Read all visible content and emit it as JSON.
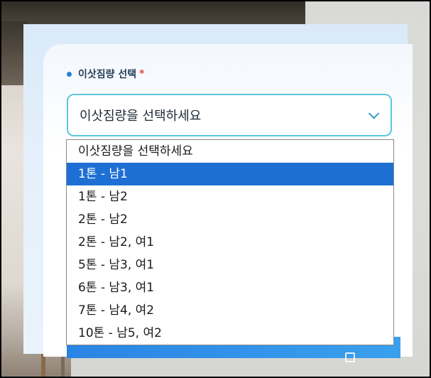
{
  "field": {
    "label": "이삿짐량 선택",
    "required_mark": "*"
  },
  "select": {
    "value": "이삿짐량을 선택하세요"
  },
  "dropdown": {
    "options": [
      "이삿짐량을 선택하세요",
      "1톤 - 남1",
      "1톤 - 남2",
      "2톤 - 남2",
      "2톤 - 남2, 여1",
      "5톤 - 남3, 여1",
      "6톤 - 남3, 여1",
      "7톤 - 남4, 여2",
      "10톤 - 남5, 여2"
    ],
    "highlighted_index": 1
  },
  "colors": {
    "accent": "#2b7de0",
    "select_border": "#5ac7e0",
    "highlight": "#1e6fd4",
    "required": "#e04848"
  },
  "icons": {
    "label_dot": "dot-icon",
    "select_chevron": "chevron-down-icon",
    "submit_icon": "checkbox-icon"
  }
}
